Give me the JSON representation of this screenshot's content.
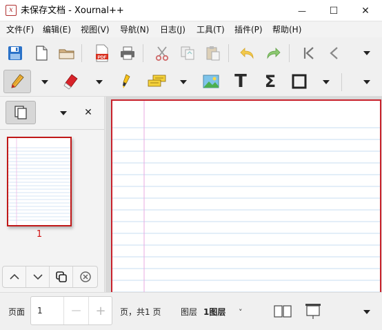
{
  "window": {
    "title": "未保存文档 - Xournal++",
    "app_icon_glyph": "x",
    "minimize_glyph": "—",
    "maximize_glyph": "☐",
    "close_glyph": "✕"
  },
  "menu": [
    "文件(F)",
    "编辑(E)",
    "视图(V)",
    "导航(N)",
    "日志(J)",
    "工具(T)",
    "插件(P)",
    "帮助(H)"
  ],
  "toolbar1": {
    "icons": [
      "save-icon",
      "new-document-icon",
      "open-folder-icon",
      "export-pdf-icon",
      "print-icon",
      "cut-icon",
      "copy-icon",
      "paste-icon",
      "undo-icon",
      "redo-icon",
      "first-page-icon",
      "previous-page-icon"
    ],
    "pdf_text": "PDF"
  },
  "toolbar2": {
    "icons": [
      "pen-icon",
      "eraser-icon",
      "highlighter-icon",
      "text-paste-icon",
      "image-icon",
      "text-tool-icon",
      "math-tex-icon",
      "shape-rectangle-icon"
    ],
    "text_glyph": "T",
    "sigma_glyph": "Σ"
  },
  "sidebar": {
    "close_glyph": "✕",
    "page_number": "1"
  },
  "status": {
    "page_label": "页面",
    "page_value": "1",
    "minus": "—",
    "plus": "+",
    "page_of": "页，共1 页",
    "layer_label": "图层",
    "layer_value": "1图层",
    "layer_chevron": "˅"
  },
  "colors": {
    "accent_red": "#c8202a",
    "ruled_blue": "#c7dcf0",
    "margin_pink": "#e8a8e0"
  }
}
